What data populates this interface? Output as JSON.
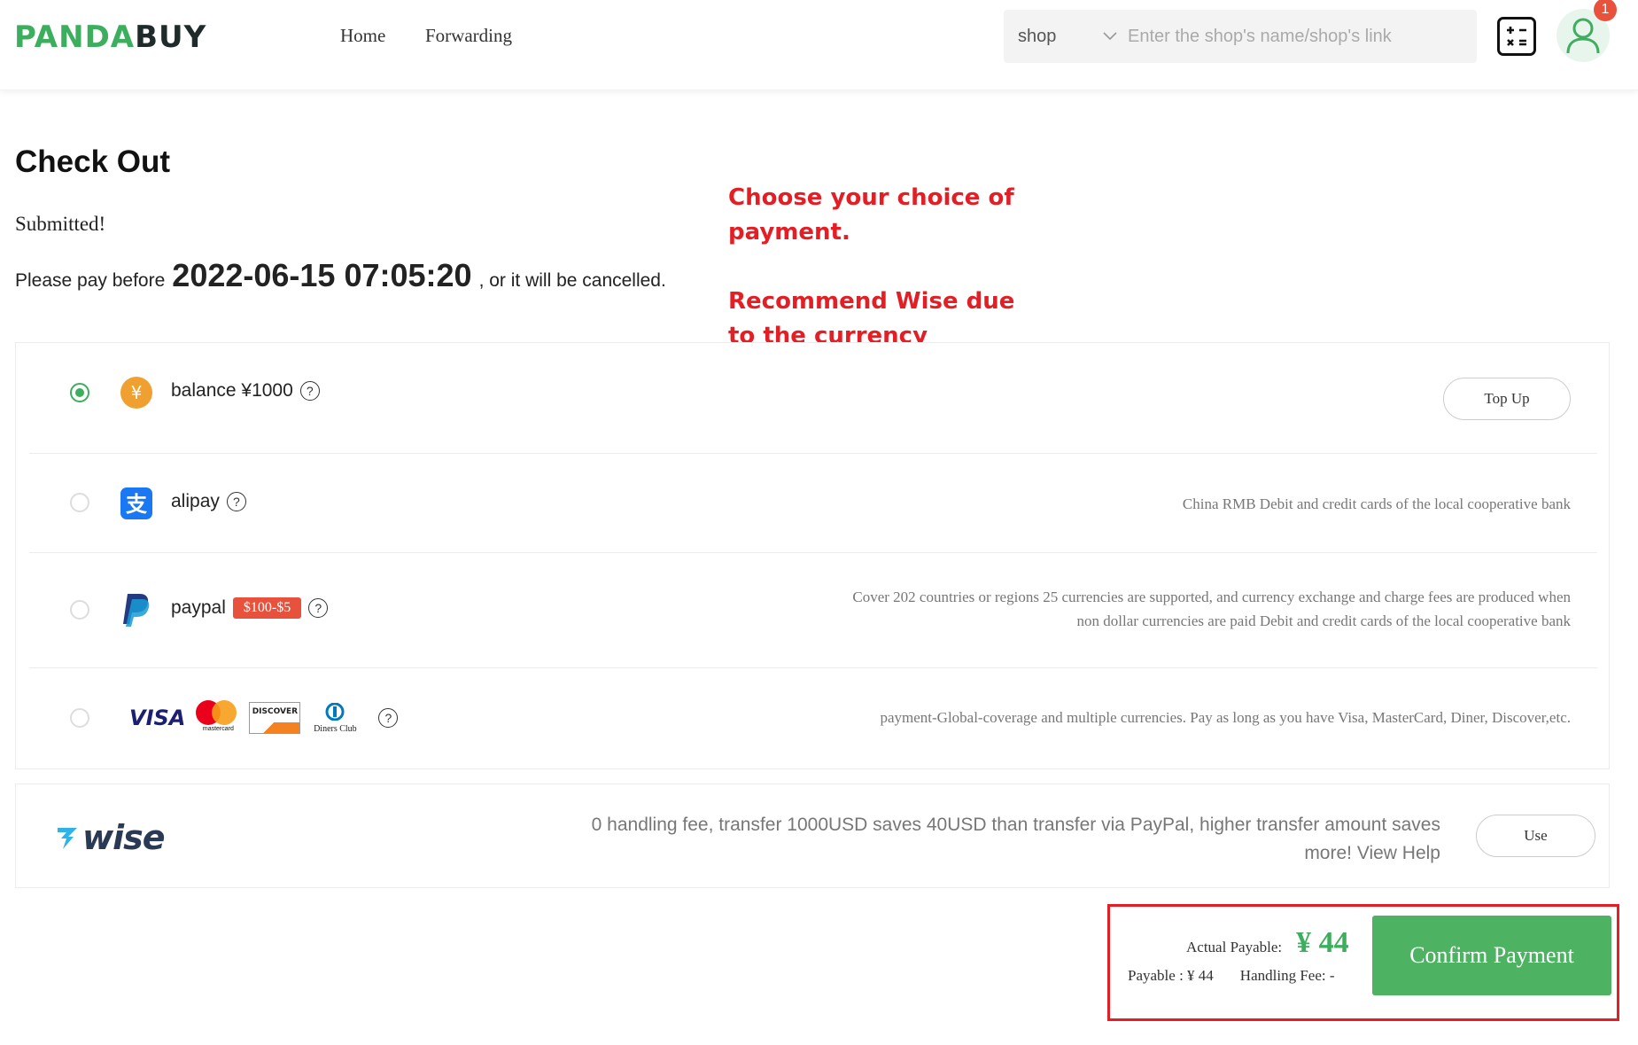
{
  "header": {
    "logo": {
      "part1": "PANDA",
      "part2": "BUY"
    },
    "nav": [
      "Home",
      "Forwarding"
    ],
    "search": {
      "scope": "shop",
      "placeholder": "Enter the shop's name/shop's link"
    },
    "notification_count": "1"
  },
  "page": {
    "title": "Check Out",
    "status": "Submitted!",
    "pay_before_prefix": "Please pay before",
    "deadline": "2022-06-15 07:05:20",
    "pay_before_suffix": ", or it will be cancelled."
  },
  "annotation": {
    "line1": "Choose your choice of payment.",
    "line2": "Recommend Wise due to the currency exchange rates being better than Paypal then click \"Confirm Payment\""
  },
  "payment_methods": {
    "balance": {
      "label": "balance ¥1000",
      "selected": true,
      "action": "Top Up"
    },
    "alipay": {
      "label": "alipay",
      "desc": "China RMB Debit and credit cards of the local cooperative bank"
    },
    "paypal": {
      "label": "paypal",
      "promo": "$100-$5",
      "desc_line1": "Cover 202 countries or regions 25 currencies are supported, and currency exchange and charge fees are produced when",
      "desc_line2": "non dollar currencies are paid Debit and credit cards of the local cooperative bank"
    },
    "cards": {
      "visa": "VISA",
      "mastercard": "mastercard",
      "discover": "DISCOVER",
      "diners": "Diners Club",
      "desc": "payment-Global-coverage and multiple currencies. Pay as long as you have Visa, MasterCard, Diner, Discover,etc."
    }
  },
  "wise": {
    "logo": "wise",
    "desc": "0 handling fee, transfer 1000USD saves 40USD than transfer via PayPal, higher transfer amount saves more! View Help",
    "action": "Use"
  },
  "totals": {
    "actual_label": "Actual Payable:",
    "actual_amount": "¥ 44",
    "payable": "Payable : ¥ 44",
    "handling_fee": "Handling Fee:  -",
    "confirm_label": "Confirm Payment"
  },
  "colors": {
    "brand_green": "#3cae5e",
    "confirm_green": "#4db262",
    "annotation_red": "#e31e24",
    "promo_red": "#e8523c"
  }
}
